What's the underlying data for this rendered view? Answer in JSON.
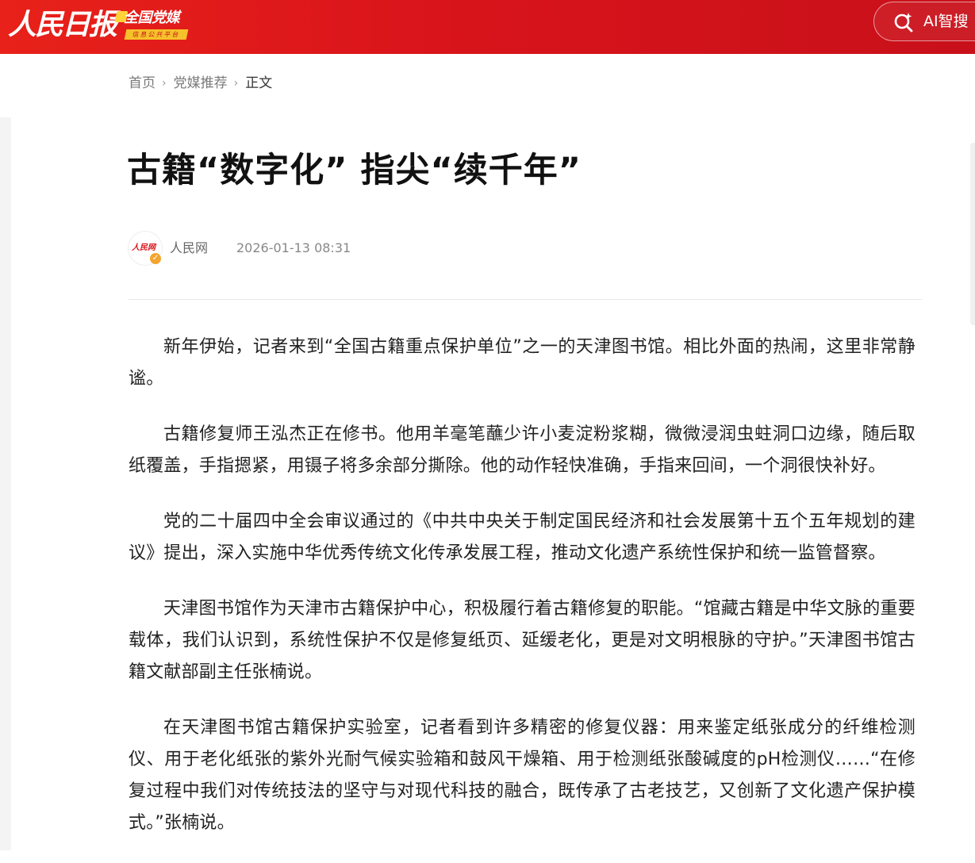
{
  "header": {
    "logo_text": "人民日报",
    "badge_title": "全国党媒",
    "badge_subtitle": "信息公共平台",
    "ai_search_label": "AI智搜",
    "ai_search_icon": "ai-search-icon",
    "brand_color": "#d9141b"
  },
  "breadcrumb": {
    "items": [
      {
        "label": "首页"
      },
      {
        "label": "党媒推荐"
      }
    ],
    "separator": "›",
    "current": "正文"
  },
  "article": {
    "title": "古籍“数字化” 指尖“续千年”",
    "source_avatar_text": "人民网",
    "source": "人民网",
    "publish_time": "2026-01-13 08:31",
    "verified_mark": "✓",
    "paragraphs": [
      "新年伊始，记者来到“全国古籍重点保护单位”之一的天津图书馆。相比外面的热闹，这里非常静谧。",
      "古籍修复师王泓杰正在修书。他用羊毫笔蘸少许小麦淀粉浆糊，微微浸润虫蛀洞口边缘，随后取纸覆盖，手指摁紧，用镊子将多余部分撕除。他的动作轻快准确，手指来回间，一个洞很快补好。",
      "党的二十届四中全会审议通过的《中共中央关于制定国民经济和社会发展第十五个五年规划的建议》提出，深入实施中华优秀传统文化传承发展工程，推动文化遗产系统性保护和统一监管督察。",
      "天津图书馆作为天津市古籍保护中心，积极履行着古籍修复的职能。“馆藏古籍是中华文脉的重要载体，我们认识到，系统性保护不仅是修复纸页、延缓老化，更是对文明根脉的守护。”天津图书馆古籍文献部副主任张楠说。",
      "在天津图书馆古籍保护实验室，记者看到许多精密的修复仪器：用来鉴定纸张成分的纤维检测仪、用于老化纸张的紫外光耐气候实验箱和鼓风干燥箱、用于检测纸张酸碱度的pH检测仪……“在修复过程中我们对传统技法的坚守与对现代科技的融合，既传承了古老技艺，又创新了文化遗产保护模式。”张楠说。"
    ]
  }
}
